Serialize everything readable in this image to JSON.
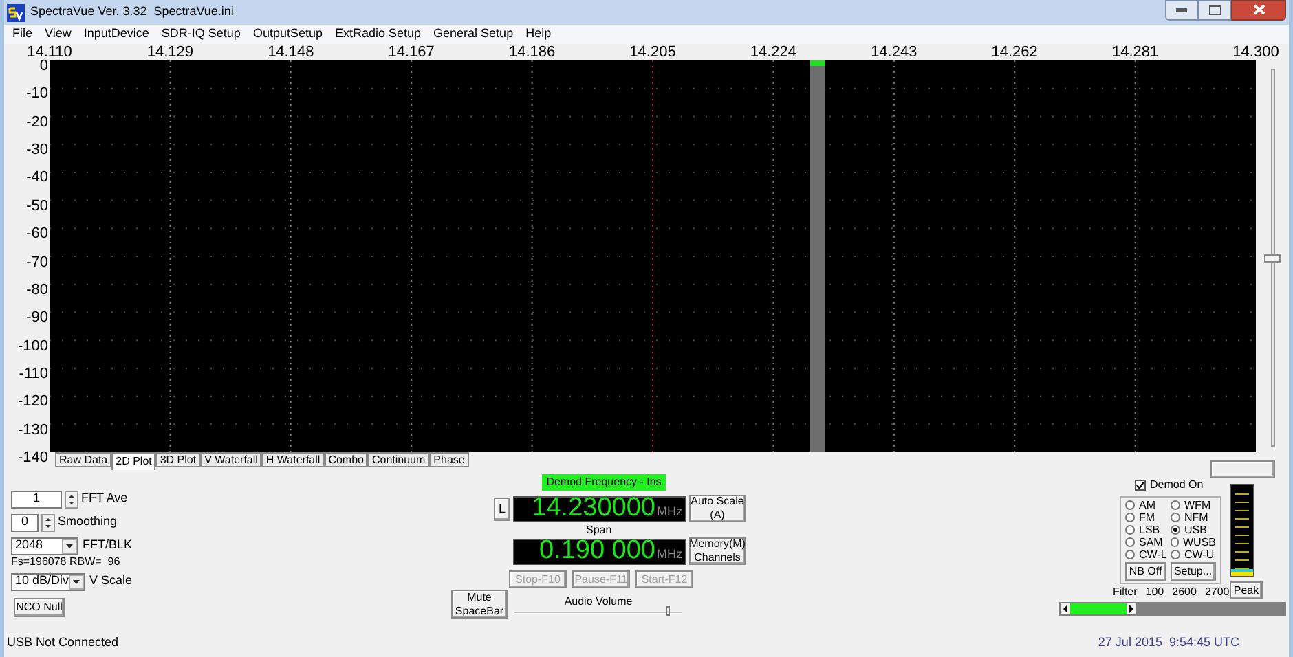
{
  "window": {
    "title": "SpectraVue Ver. 3.32  SpectraVue.ini"
  },
  "menu": [
    "File",
    "View",
    "InputDevice",
    "SDR-IQ Setup",
    "OutputSetup",
    "ExtRadio Setup",
    "General Setup",
    "Help"
  ],
  "plot": {
    "x_labels": [
      "14.110",
      "14.129",
      "14.148",
      "14.167",
      "14.186",
      "14.205",
      "14.224",
      "14.243",
      "14.262",
      "14.281",
      "14.300"
    ],
    "y_labels": [
      "0",
      "-10",
      "-20",
      "-30",
      "-40",
      "-50",
      "-60",
      "-70",
      "-80",
      "-90",
      "-100",
      "-110",
      "-120",
      "-130",
      "-140"
    ]
  },
  "reference_slider": {
    "level": 0.5
  },
  "tabs": [
    {
      "label": "Raw Data",
      "selected": false
    },
    {
      "label": "2D Plot",
      "selected": true
    },
    {
      "label": "3D Plot",
      "selected": false
    },
    {
      "label": "V Waterfall",
      "selected": false
    },
    {
      "label": "H Waterfall",
      "selected": false
    },
    {
      "label": "Combo",
      "selected": false
    },
    {
      "label": "Continuum",
      "selected": false
    },
    {
      "label": "Phase",
      "selected": false
    }
  ],
  "fft_ave": {
    "value": "1",
    "label": "FFT Ave"
  },
  "smoothing": {
    "value": "0",
    "label": "Smoothing"
  },
  "fft_blk": {
    "value": "2048",
    "label": "FFT/BLK"
  },
  "fs_info": "Fs=196078 RBW=  96",
  "v_scale": {
    "value": "10 dB/Div",
    "label": "V Scale"
  },
  "nco_null": "NCO Null",
  "demod_label": "Demod Frequency - Ins",
  "l_button": "L",
  "frequency": {
    "value": "14.230000",
    "unit": "MHz"
  },
  "auto_scale": [
    "Auto Scale",
    "(A)"
  ],
  "span_label": "Span",
  "span": {
    "value": "0.190 000",
    "unit": "MHz"
  },
  "memory": [
    "Memory(M)",
    "Channels"
  ],
  "transport": [
    {
      "label": "Stop-F10",
      "disabled": true
    },
    {
      "label": "Pause-F11",
      "disabled": true
    },
    {
      "label": "Start-F12",
      "disabled": true
    }
  ],
  "mute": [
    "Mute",
    "SpaceBar"
  ],
  "audio_volume": {
    "label": "Audio Volume",
    "level": 0.9
  },
  "demod_on": {
    "label": "Demod On",
    "checked": true
  },
  "modes": [
    {
      "label": "AM",
      "selected": false
    },
    {
      "label": "WFM",
      "selected": false
    },
    {
      "label": "FM",
      "selected": false
    },
    {
      "label": "NFM",
      "selected": false
    },
    {
      "label": "LSB",
      "selected": false
    },
    {
      "label": "USB",
      "selected": true
    },
    {
      "label": "SAM",
      "selected": false
    },
    {
      "label": "WUSB",
      "selected": false
    },
    {
      "label": "CW-L",
      "selected": false
    },
    {
      "label": "CW-U",
      "selected": false
    }
  ],
  "nb_button": "NB Off",
  "setup_button": "Setup...",
  "meter": {
    "level": 0.08
  },
  "peak": "Peak",
  "filter": [
    "Filter",
    "100",
    "2600",
    "2700"
  ],
  "filter_slider": {
    "level": 0.26
  },
  "status": {
    "left": "USB Not Connected",
    "right": "27 Jul 2015  9:54:45 UTC"
  }
}
